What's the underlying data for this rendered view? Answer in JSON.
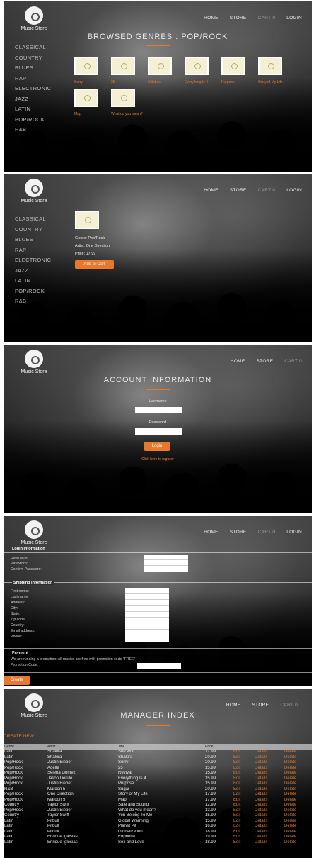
{
  "app": {
    "logo_text": "Music Store"
  },
  "screens": {
    "genre_browse": {
      "nav": [
        "HOME",
        "STORE",
        "CART 0",
        "LOGIN"
      ],
      "title": "BROWSED GENRES : POP/ROCK",
      "genres": [
        "CLASSICAL",
        "COUNTRY",
        "BLUES",
        "RAP",
        "ELECTRONIC",
        "JAZZ",
        "LATIN",
        "POP/ROCK",
        "R&B"
      ],
      "albums": [
        "Sorry",
        "25",
        "Stitches",
        "Everything Is 4",
        "Purpose",
        "Story of My Life",
        "Map",
        "What do you mean?"
      ]
    },
    "album_details": {
      "nav": [
        "HOME",
        "STORE",
        "CART 0",
        "LOGIN"
      ],
      "genres": [
        "CLASSICAL",
        "COUNTRY",
        "BLUES",
        "RAP",
        "ELECTRONIC",
        "JAZZ",
        "LATIN",
        "POP/ROCK",
        "R&B"
      ],
      "genre_line": "Genre: Pop/Rock",
      "artist_line": "Artist: One Direction",
      "price_line": "Price: 17.99",
      "add_to_cart": "Add to Cart"
    },
    "login": {
      "nav": [
        "HOME",
        "STORE",
        "CART 0"
      ],
      "title": "ACCOUNT INFORMATION",
      "username_label": "Username",
      "password_label": "Password",
      "login_button": "Login",
      "register_link": "Click here to register"
    },
    "checkout": {
      "nav": [
        "HOME",
        "STORE",
        "CART 0",
        "LOGIN"
      ],
      "login_section": "Login Information",
      "login_fields": [
        "Username:",
        "Password:",
        "Confirm Password:"
      ],
      "shipping_section": "Shipping Information",
      "shipping_fields": [
        "First name:",
        "Last name:",
        "Address:",
        "City:",
        "State:",
        "Zip code:",
        "Country:",
        "Email address:",
        "Phone:"
      ],
      "payment_section": "Payment",
      "promo_text": "We are running a promotion: All musics are free with promotion code \"FREE\"",
      "promo_label": "Promotion Code:",
      "create_button": "Create"
    },
    "manager": {
      "nav": [
        "HOME",
        "STORE",
        "CART 0"
      ],
      "title": "MANAGER INDEX",
      "create_link": "CREATE NEW",
      "columns": [
        "Genre",
        "Artist",
        "Title",
        "Price",
        "",
        "",
        ""
      ],
      "actions": [
        "Edit",
        "Details",
        "Delete"
      ],
      "rows": [
        [
          "Latin",
          "Shakira",
          "She wolf",
          "17.99"
        ],
        [
          "Latin",
          "Shakira",
          "Shakira",
          "20.99"
        ],
        [
          "Pop/Rock",
          "Justin Bieber",
          "Sorry",
          "20.99"
        ],
        [
          "Pop/Rock",
          "Adelle",
          "25",
          "15.99"
        ],
        [
          "Pop/Rock",
          "Selena Gomez",
          "Revival",
          "15.99"
        ],
        [
          "Pop/Rock",
          "Jason Derulo",
          "Everything Is 4",
          "15.99"
        ],
        [
          "Pop/Rock",
          "Justin Bieber",
          "Purpose",
          "15.99"
        ],
        [
          "R&B",
          "Maroon 5",
          "Sugar",
          "20.99"
        ],
        [
          "Pop/Rock",
          "One Direction",
          "Story of My Life",
          "17.99"
        ],
        [
          "Pop/Rock",
          "Maroon 5",
          "Map",
          "17.99"
        ],
        [
          "Country",
          "Taylor Swift",
          "Safe and Sound",
          "12.99"
        ],
        [
          "Pop/Rock",
          "Justin Bieber",
          "What do you mean?",
          "13.99"
        ],
        [
          "Country",
          "Taylor Swift",
          "You Belong To Me",
          "15.99"
        ],
        [
          "Latin",
          "Pitbull",
          "Global Warming",
          "15.99"
        ],
        [
          "Latin",
          "Pitbull",
          "Planet Pit",
          "16.99"
        ],
        [
          "Latin",
          "Pitbull",
          "Globalization",
          "18.99"
        ],
        [
          "Latin",
          "Enrique Iglesias",
          "Euphoria",
          "19.99"
        ],
        [
          "Latin",
          "Enrique Iglesias",
          "Sex and Love",
          "18.99"
        ]
      ]
    }
  }
}
